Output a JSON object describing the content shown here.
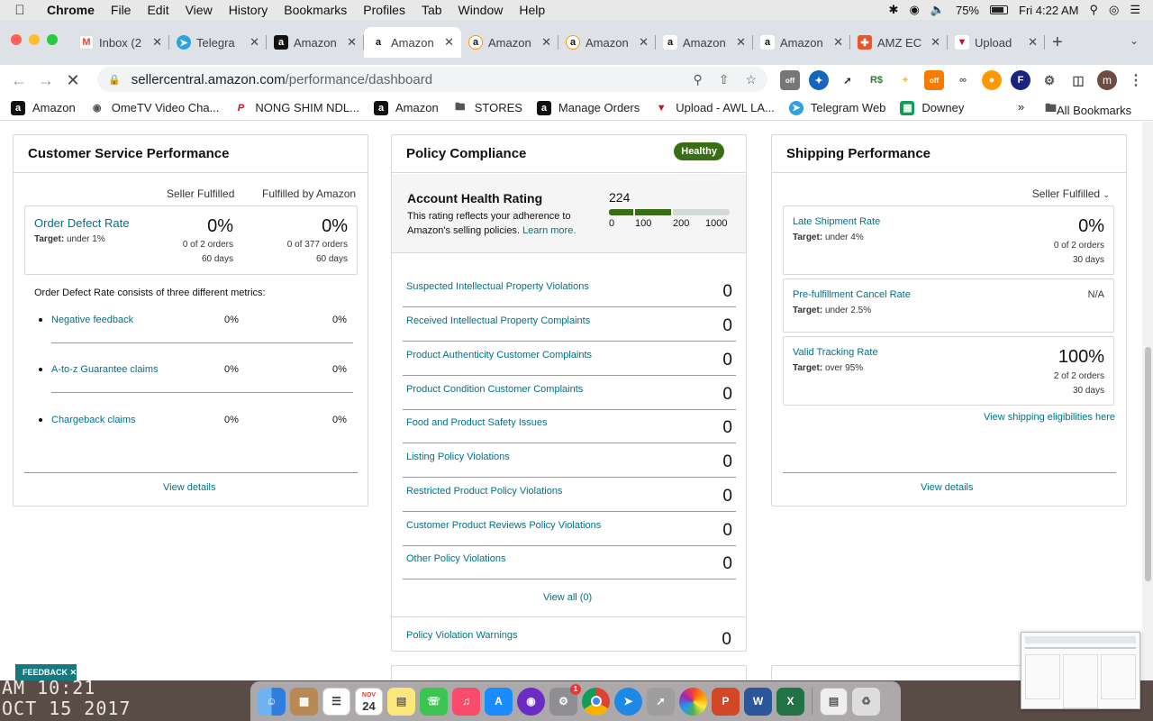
{
  "menubar": {
    "app_name": "Chrome",
    "items": [
      "File",
      "Edit",
      "View",
      "History",
      "Bookmarks",
      "Profiles",
      "Tab",
      "Window",
      "Help"
    ],
    "battery": "75%",
    "clock": "Fri 4:22 AM"
  },
  "tabs": [
    {
      "title": "Inbox (2",
      "favicon": "gmail-icon"
    },
    {
      "title": "Telegra",
      "favicon": "telegram-icon"
    },
    {
      "title": "Amazon",
      "favicon": "amazon-icon"
    },
    {
      "title": "Amazon",
      "favicon": "amazon-smile-icon",
      "active": true
    },
    {
      "title": "Amazon",
      "favicon": "amazon-smile-icon"
    },
    {
      "title": "Amazon",
      "favicon": "amazon-smile-icon"
    },
    {
      "title": "Amazon",
      "favicon": "amazon-smile-icon"
    },
    {
      "title": "Amazon",
      "favicon": "amazon-smile-icon"
    },
    {
      "title": "AMZ EC",
      "favicon": "amz-ec-icon"
    },
    {
      "title": "Upload",
      "favicon": "upload-icon"
    }
  ],
  "toolbar": {
    "url_domain": "sellercentral.amazon.com",
    "url_path": "/performance/dashboard",
    "ext_off_label": "off",
    "avatar_letter": "m"
  },
  "bookmarks": [
    {
      "label": "Amazon",
      "icon": "amazon-icon"
    },
    {
      "label": "OmeTV Video Cha...",
      "icon": "ometv-icon"
    },
    {
      "label": "NONG SHIM NDL...",
      "icon": "pinterest-icon"
    },
    {
      "label": "Amazon",
      "icon": "amazon-icon"
    },
    {
      "label": "STORES",
      "icon": "folder-icon"
    },
    {
      "label": "Manage Orders",
      "icon": "amazon-icon"
    },
    {
      "label": "Upload - AWL LA...",
      "icon": "upload-icon"
    },
    {
      "label": "Telegram Web",
      "icon": "telegram-icon"
    },
    {
      "label": "Downey",
      "icon": "sheets-icon"
    }
  ],
  "bookmarks_all": "All Bookmarks",
  "customer_service": {
    "title": "Customer Service Performance",
    "col_seller": "Seller Fulfilled",
    "col_fba": "Fulfilled by Amazon",
    "odr": {
      "name": "Order Defect Rate",
      "target_label": "Target:",
      "target_value": "under 1%",
      "seller_pct": "0%",
      "seller_orders": "0 of 2 orders",
      "seller_days": "60 days",
      "fba_pct": "0%",
      "fba_orders": "0 of 377 orders",
      "fba_days": "60 days"
    },
    "consists_text": "Order Defect Rate consists of three different metrics:",
    "metrics": [
      {
        "name": "Negative feedback",
        "seller": "0%",
        "fba": "0%"
      },
      {
        "name": "A-to-z Guarantee claims",
        "seller": "0%",
        "fba": "0%"
      },
      {
        "name": "Chargeback claims",
        "seller": "0%",
        "fba": "0%"
      }
    ],
    "view_details": "View details"
  },
  "policy": {
    "title": "Policy Compliance",
    "badge": "Healthy",
    "ahr_title": "Account Health Rating",
    "ahr_desc_1": "This rating reflects your adherence to",
    "ahr_desc_2": "Amazon's selling policies.",
    "learn_more": "Learn more.",
    "score": "224",
    "score_value": 224,
    "scale": [
      "0",
      "100",
      "200",
      "1000"
    ],
    "rows": [
      {
        "name": "Suspected Intellectual Property Violations",
        "value": "0"
      },
      {
        "name": "Received Intellectual Property Complaints",
        "value": "0"
      },
      {
        "name": "Product Authenticity Customer Complaints",
        "value": "0"
      },
      {
        "name": "Product Condition Customer Complaints",
        "value": "0"
      },
      {
        "name": "Food and Product Safety Issues",
        "value": "0"
      },
      {
        "name": "Listing Policy Violations",
        "value": "0"
      },
      {
        "name": "Restricted Product Policy Violations",
        "value": "0"
      },
      {
        "name": "Customer Product Reviews Policy Violations",
        "value": "0"
      },
      {
        "name": "Other Policy Violations",
        "value": "0"
      }
    ],
    "view_all": "View all (0)",
    "warnings": {
      "name": "Policy Violation Warnings",
      "value": "0"
    }
  },
  "shipping": {
    "title": "Shipping Performance",
    "filter": "Seller Fulfilled",
    "late": {
      "name": "Late Shipment Rate",
      "target_label": "Target:",
      "target_value": "under 4%",
      "pct": "0%",
      "orders": "0 of 2 orders",
      "days": "30 days"
    },
    "cancel": {
      "name": "Pre-fulfillment Cancel Rate",
      "target_label": "Target:",
      "target_value": "under 2.5%",
      "value": "N/A"
    },
    "tracking": {
      "name": "Valid Tracking Rate",
      "target_label": "Target:",
      "target_value": "over 95%",
      "pct": "100%",
      "orders": "2 of 2 orders",
      "days": "30 days"
    },
    "eligibilities": "View shipping eligibilities here",
    "view_details": "View details"
  },
  "feedback_label": "FEEDBACK",
  "desktop_clock_line1": "AM 10:21",
  "desktop_clock_line2": "OCT 15 2017",
  "dock_calendar_month": "NOV",
  "dock_calendar_day": "24",
  "dock_settings_badge": "1"
}
